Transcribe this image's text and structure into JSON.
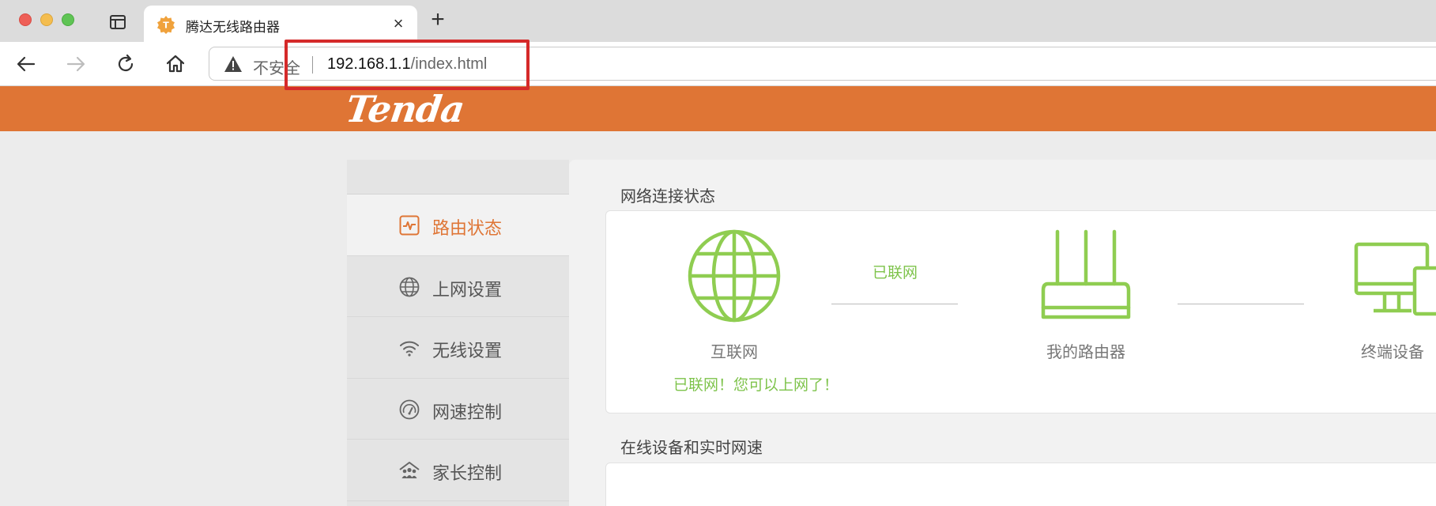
{
  "browser": {
    "tab": {
      "title": "腾达无线路由器",
      "close_glyph": "×"
    },
    "new_tab_glyph": "+",
    "address_bar": {
      "security_label": "不安全",
      "url_host": "192.168.1.1",
      "url_path": "/index.html"
    }
  },
  "page": {
    "brand": "Tenda",
    "menu": [
      {
        "label": "路由状态",
        "icon": "activity-icon",
        "active": true
      },
      {
        "label": "上网设置",
        "icon": "globe-icon"
      },
      {
        "label": "无线设置",
        "icon": "wifi-icon"
      },
      {
        "label": "网速控制",
        "icon": "speedometer-icon"
      },
      {
        "label": "家长控制",
        "icon": "family-icon"
      }
    ],
    "status_section": {
      "title": "网络连接状态",
      "internet_label": "互联网",
      "connection_label": "已联网",
      "router_label": "我的路由器",
      "terminal_label": "终端设备",
      "online_message": "已联网！您可以上网了！"
    },
    "devices_section": {
      "title": "在线设备和实时网速"
    }
  },
  "colors": {
    "brand_orange": "#df7535",
    "status_green": "#7ec34b",
    "highlight_red": "#d52a2a"
  }
}
